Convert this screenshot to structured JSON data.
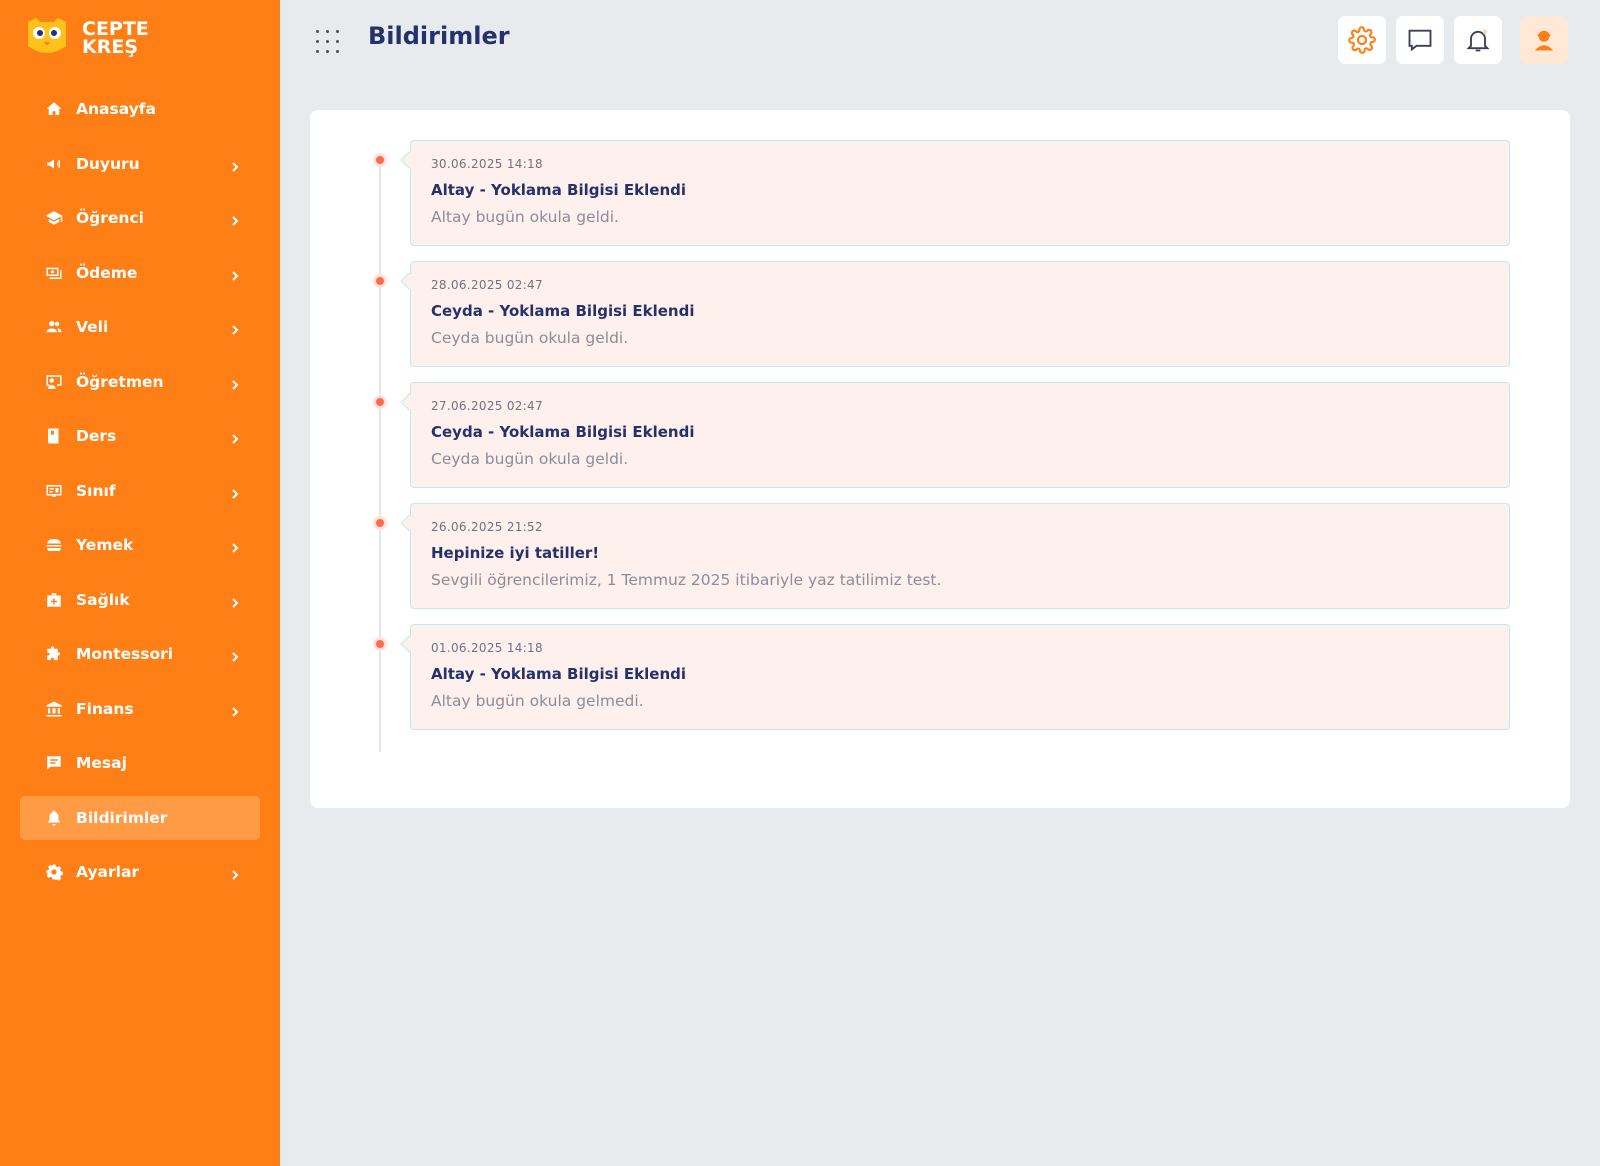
{
  "brand": {
    "line1": "CEPTE",
    "line2": "KREŞ"
  },
  "colors": {
    "sidebar": "#fe7f15",
    "active": "#ff9a45",
    "title": "#25326a",
    "dot": "#ff6b4a",
    "boxBg": "#fdf0ed",
    "boxBorder": "#bfeee8"
  },
  "sidebar": {
    "items": [
      {
        "label": "Anasayfa",
        "icon": "home-icon",
        "chevron": false,
        "active": false
      },
      {
        "label": "Duyuru",
        "icon": "megaphone-icon",
        "chevron": true,
        "active": false
      },
      {
        "label": "Öğrenci",
        "icon": "graduation-cap-icon",
        "chevron": true,
        "active": false
      },
      {
        "label": "Ödeme",
        "icon": "payment-icon",
        "chevron": true,
        "active": false
      },
      {
        "label": "Veli",
        "icon": "users-icon",
        "chevron": true,
        "active": false
      },
      {
        "label": "Öğretmen",
        "icon": "teacher-icon",
        "chevron": true,
        "active": false
      },
      {
        "label": "Ders",
        "icon": "book-icon",
        "chevron": true,
        "active": false
      },
      {
        "label": "Sınıf",
        "icon": "classroom-icon",
        "chevron": true,
        "active": false
      },
      {
        "label": "Yemek",
        "icon": "burger-icon",
        "chevron": true,
        "active": false
      },
      {
        "label": "Sağlık",
        "icon": "medkit-icon",
        "chevron": true,
        "active": false
      },
      {
        "label": "Montessori",
        "icon": "puzzle-icon",
        "chevron": true,
        "active": false
      },
      {
        "label": "Finans",
        "icon": "bank-icon",
        "chevron": true,
        "active": false
      },
      {
        "label": "Mesaj",
        "icon": "message-icon",
        "chevron": false,
        "active": false
      },
      {
        "label": "Bildirimler",
        "icon": "bell-icon",
        "chevron": false,
        "active": true
      },
      {
        "label": "Ayarlar",
        "icon": "gear-icon",
        "chevron": true,
        "active": false
      }
    ]
  },
  "header": {
    "title": "Bildirimler",
    "buttons": [
      "settings-icon",
      "chat-icon",
      "bell-icon",
      "user-avatar-icon"
    ]
  },
  "notifications": [
    {
      "date": "30.06.2025 14:18",
      "title": "Altay - Yoklama Bilgisi Eklendi",
      "message": "Altay bugün okula geldi."
    },
    {
      "date": "28.06.2025 02:47",
      "title": "Ceyda - Yoklama Bilgisi Eklendi",
      "message": "Ceyda bugün okula geldi."
    },
    {
      "date": "27.06.2025 02:47",
      "title": "Ceyda - Yoklama Bilgisi Eklendi",
      "message": "Ceyda bugün okula geldi."
    },
    {
      "date": "26.06.2025 21:52",
      "title": "Hepinize iyi tatiller!",
      "message": "Sevgili öğrencilerimiz, 1 Temmuz 2025 itibariyle yaz tatilimiz test."
    },
    {
      "date": "01.06.2025 14:18",
      "title": "Altay - Yoklama Bilgisi Eklendi",
      "message": "Altay bugün okula gelmedi."
    }
  ]
}
